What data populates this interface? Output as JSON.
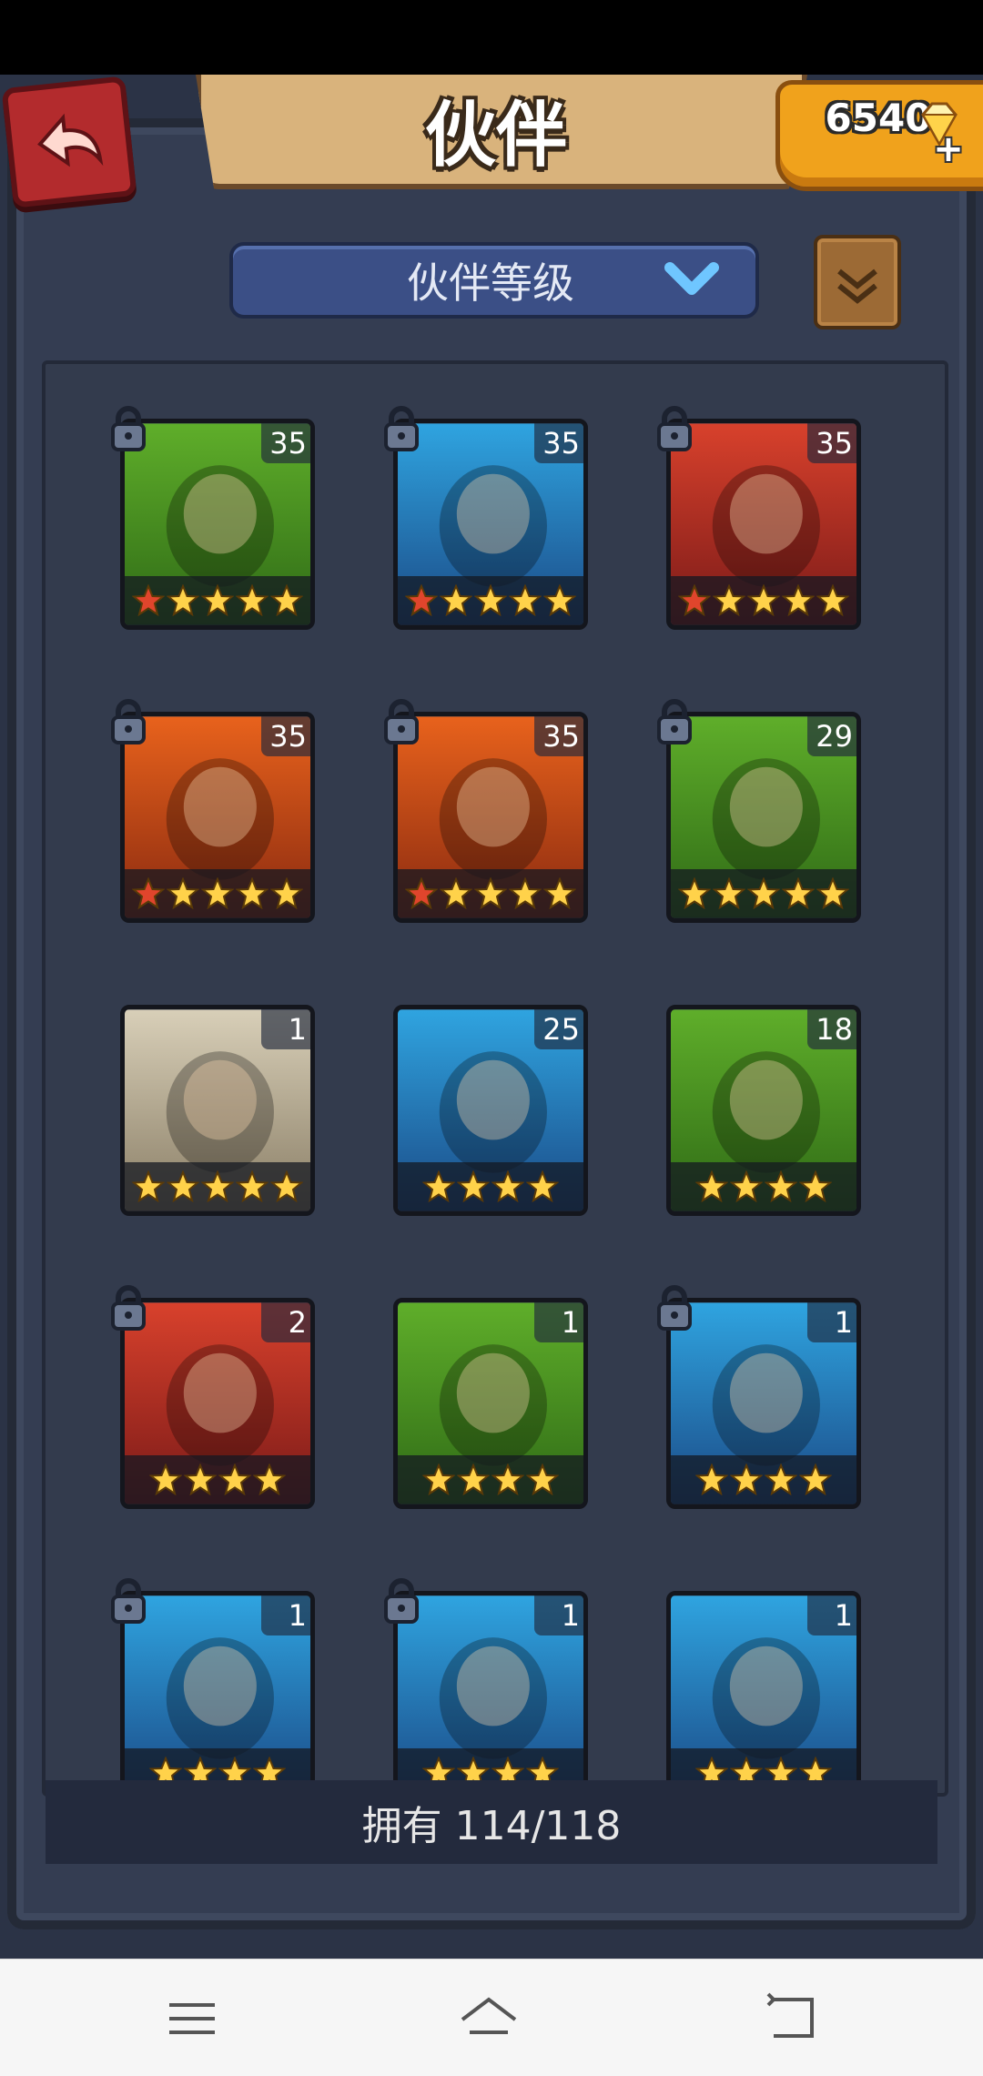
{
  "header": {
    "title": "伙伴",
    "gems": "6540",
    "gem_plus": "+"
  },
  "sort": {
    "label": "伙伴等级"
  },
  "footer": {
    "owned_text": "拥有 114/118"
  },
  "colors": {
    "background": "#2b3346",
    "panel": "#333b4d",
    "dropdown": "#3b4f86",
    "gem_box": "#f0a21c",
    "back_button": "#b32b2d",
    "star_gold": "#ffd24a",
    "star_red": "#e0452c"
  },
  "cards": [
    {
      "level": "35",
      "locked": true,
      "stars": 5,
      "red_stars": 1,
      "theme": "green",
      "icon": "croc-hero-portrait"
    },
    {
      "level": "35",
      "locked": true,
      "stars": 5,
      "red_stars": 1,
      "theme": "blue",
      "icon": "hooded-rogue-portrait"
    },
    {
      "level": "35",
      "locked": true,
      "stars": 5,
      "red_stars": 1,
      "theme": "red",
      "icon": "tusked-beast-portrait"
    },
    {
      "level": "35",
      "locked": true,
      "stars": 5,
      "red_stars": 1,
      "theme": "orange",
      "icon": "barbarian-portrait"
    },
    {
      "level": "35",
      "locked": true,
      "stars": 5,
      "red_stars": 1,
      "theme": "orange",
      "icon": "afro-heroine-portrait"
    },
    {
      "level": "29",
      "locked": true,
      "stars": 5,
      "red_stars": 0,
      "theme": "green",
      "icon": "ranger-portrait"
    },
    {
      "level": "1",
      "locked": false,
      "stars": 5,
      "red_stars": 0,
      "theme": "cream",
      "icon": "purple-elder-portrait"
    },
    {
      "level": "25",
      "locked": false,
      "stars": 4,
      "red_stars": 0,
      "theme": "blue",
      "icon": "boar-warrior-portrait"
    },
    {
      "level": "18",
      "locked": false,
      "stars": 4,
      "red_stars": 0,
      "theme": "green",
      "icon": "ranger-portrait"
    },
    {
      "level": "2",
      "locked": true,
      "stars": 4,
      "red_stars": 0,
      "theme": "red",
      "icon": "skull-totem-portrait"
    },
    {
      "level": "1",
      "locked": false,
      "stars": 4,
      "red_stars": 0,
      "theme": "green",
      "icon": "ranger-portrait"
    },
    {
      "level": "1",
      "locked": true,
      "stars": 4,
      "red_stars": 0,
      "theme": "blue",
      "icon": "skull-totem-portrait"
    },
    {
      "level": "1",
      "locked": true,
      "stars": 4,
      "red_stars": 0,
      "theme": "blue",
      "icon": "dark-heroine-portrait"
    },
    {
      "level": "1",
      "locked": true,
      "stars": 4,
      "red_stars": 0,
      "theme": "blue",
      "icon": "dark-heroine-portrait"
    },
    {
      "level": "1",
      "locked": false,
      "stars": 4,
      "red_stars": 0,
      "theme": "blue",
      "icon": "hooded-rogue-portrait"
    }
  ],
  "nav": {
    "menu": "menu-icon",
    "home": "home-icon",
    "back": "back-icon"
  }
}
